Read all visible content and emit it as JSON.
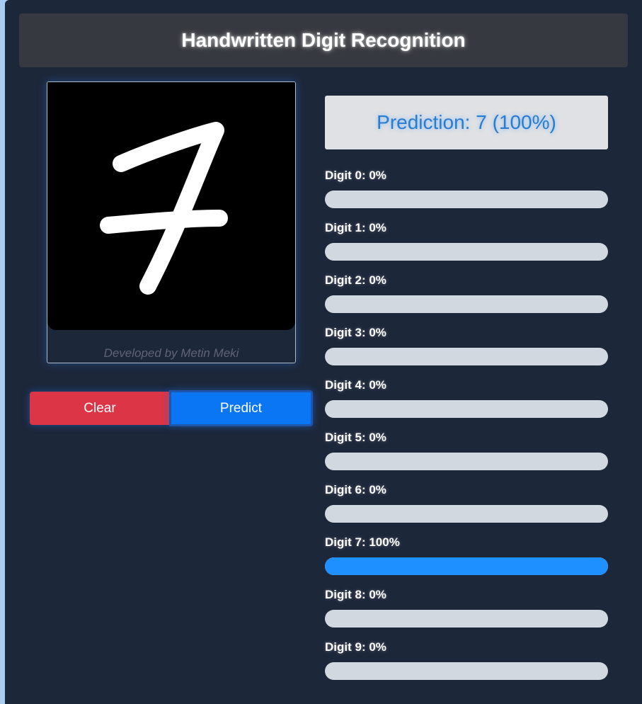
{
  "header": {
    "title": "Handwritten Digit Recognition"
  },
  "canvas": {
    "credit": "Developed by Metin Meki"
  },
  "buttons": {
    "clear_label": "Clear",
    "predict_label": "Predict"
  },
  "prediction": {
    "text": "Prediction: 7 (100%)"
  },
  "digits": [
    {
      "label": "Digit 0: 0%",
      "fraction": 0
    },
    {
      "label": "Digit 1: 0%",
      "fraction": 0
    },
    {
      "label": "Digit 2: 0%",
      "fraction": 0
    },
    {
      "label": "Digit 3: 0%",
      "fraction": 0
    },
    {
      "label": "Digit 4: 0%",
      "fraction": 0
    },
    {
      "label": "Digit 5: 0%",
      "fraction": 0
    },
    {
      "label": "Digit 6: 0%",
      "fraction": 0
    },
    {
      "label": "Digit 7: 100%",
      "fraction": 1
    },
    {
      "label": "Digit 8: 0%",
      "fraction": 0
    },
    {
      "label": "Digit 9: 0%",
      "fraction": 0
    }
  ],
  "colors": {
    "bar_fill": "#1e90ff",
    "bar_track": "#d1d8e0",
    "clear": "#dc3545",
    "predict": "#0a76f4"
  }
}
